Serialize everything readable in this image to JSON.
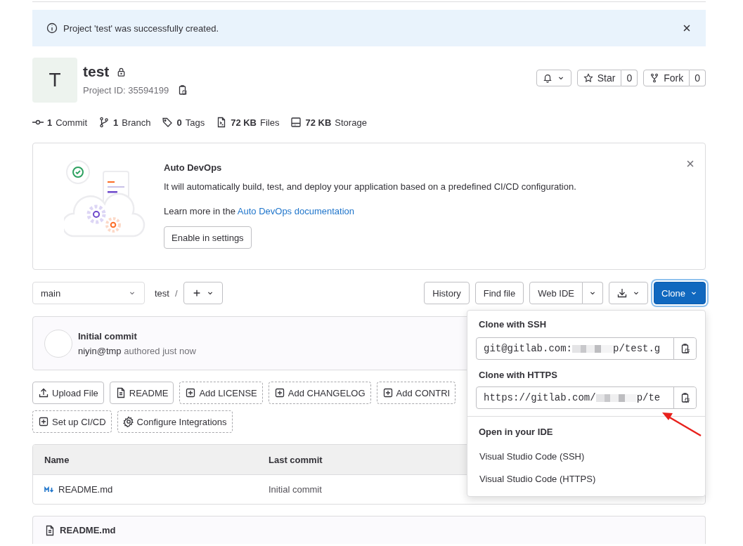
{
  "alert": {
    "message": "Project 'test' was successfully created."
  },
  "project": {
    "avatar_letter": "T",
    "name": "test",
    "project_id": "Project ID: 35594199"
  },
  "header_buttons": {
    "star": {
      "label": "Star",
      "count": "0"
    },
    "fork": {
      "label": "Fork",
      "count": "0"
    }
  },
  "stats": [
    {
      "count": "1",
      "label": "Commit"
    },
    {
      "count": "1",
      "label": "Branch"
    },
    {
      "count": "0",
      "label": "Tags"
    },
    {
      "count": "72 KB",
      "label": "Files"
    },
    {
      "count": "72 KB",
      "label": "Storage"
    }
  ],
  "auto_devops": {
    "title": "Auto DevOps",
    "description": "It will automatically build, test, and deploy your application based on a predefined CI/CD configuration.",
    "learn_more": "Learn more in the",
    "link": "Auto DevOps documentation",
    "button": "Enable in settings"
  },
  "toolbar": {
    "branch": "main",
    "path": "test",
    "separator": "/",
    "buttons": [
      "History",
      "Find file"
    ],
    "web_ide": "Web IDE",
    "clone": "Clone"
  },
  "clone_menu": {
    "expanded": true,
    "ssh_heading": "Clone with SSH",
    "ssh_prefix": "git@gitlab.com:",
    "ssh_suffix": "p/test.g",
    "https_heading": "Clone with HTTPS",
    "https_prefix": "https://gitlab.com/",
    "https_suffix": "p/te",
    "ide_heading": "Open in your IDE",
    "ide_items": [
      "Visual Studio Code (SSH)",
      "Visual Studio Code (HTTPS)"
    ]
  },
  "commit": {
    "title": "Initial commit",
    "author": "niyin@tmp",
    "meta": "authored just now"
  },
  "actions": [
    {
      "label": "Upload File",
      "kind": "existing"
    },
    {
      "label": "README",
      "kind": "existing"
    },
    {
      "label": "Add LICENSE",
      "kind": "suggested"
    },
    {
      "label": "Add CHANGELOG",
      "kind": "suggested"
    },
    {
      "label": "Add CONTRI",
      "kind": "suggested"
    },
    {
      "label": "Set up CI/CD",
      "kind": "suggested"
    },
    {
      "label": "Configure Integrations",
      "kind": "suggested"
    }
  ],
  "table": {
    "columns": [
      "Name",
      "Last commit"
    ],
    "rows": [
      {
        "name": "README.md",
        "last_commit": "Initial commit"
      }
    ]
  },
  "readme": {
    "title": "README.md"
  }
}
